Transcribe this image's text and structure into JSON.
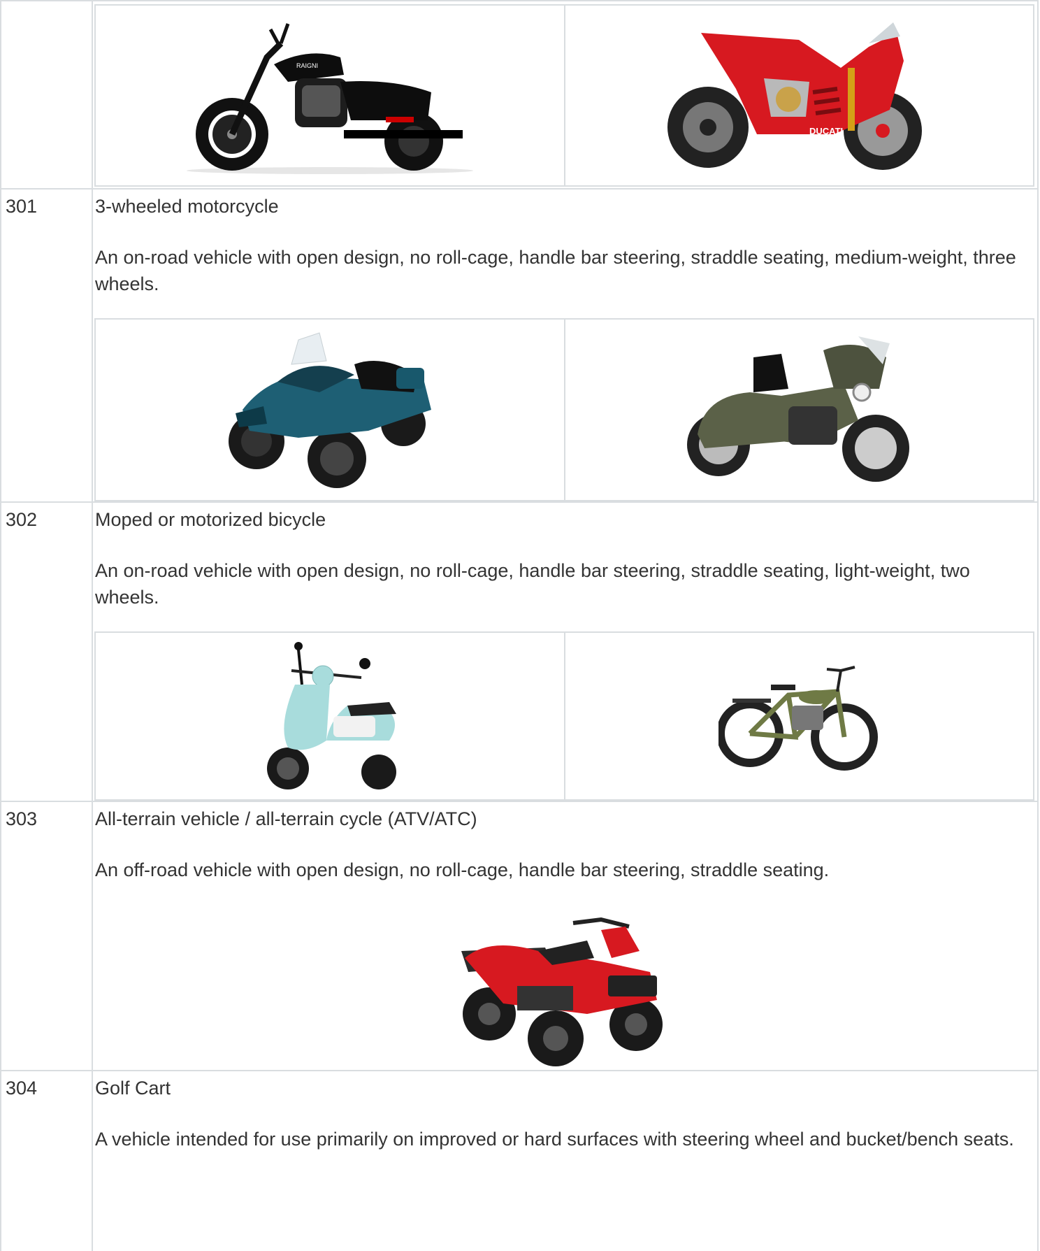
{
  "rows": [
    {
      "code": "",
      "title": "",
      "description": "",
      "images": [
        "cruiser-motorcycle-image",
        "sport-motorcycle-image"
      ]
    },
    {
      "code": "301",
      "title": "3-wheeled motorcycle",
      "description": "An on-road vehicle with open design, no roll-cage, handle bar steering, straddle seating, medium-weight, three wheels.",
      "images": [
        "three-wheel-roadster-image",
        "trike-motorcycle-image"
      ]
    },
    {
      "code": "302",
      "title": "Moped or motorized bicycle",
      "description": "An on-road vehicle with open design, no roll-cage, handle bar steering, straddle seating, light-weight, two wheels.",
      "images": [
        "scooter-image",
        "motorized-bicycle-image"
      ]
    },
    {
      "code": "303",
      "title": "All-terrain vehicle / all-terrain cycle (ATV/ATC)",
      "description": "An off-road vehicle with open design, no roll-cage, handle bar steering, straddle seating.",
      "images": [
        "atv-image"
      ]
    },
    {
      "code": "304",
      "title": "Golf Cart",
      "description": "A vehicle intended for use primarily on improved or hard surfaces with steering wheel and bucket/bench seats.",
      "images": []
    }
  ],
  "colors": {
    "border": "#d9dde0",
    "text": "#333333",
    "accent_red": "#d71920",
    "accent_teal": "#1e5f74",
    "accent_olive": "#5b6148",
    "accent_mint": "#a8dcdc",
    "accent_green": "#6f7a45"
  }
}
